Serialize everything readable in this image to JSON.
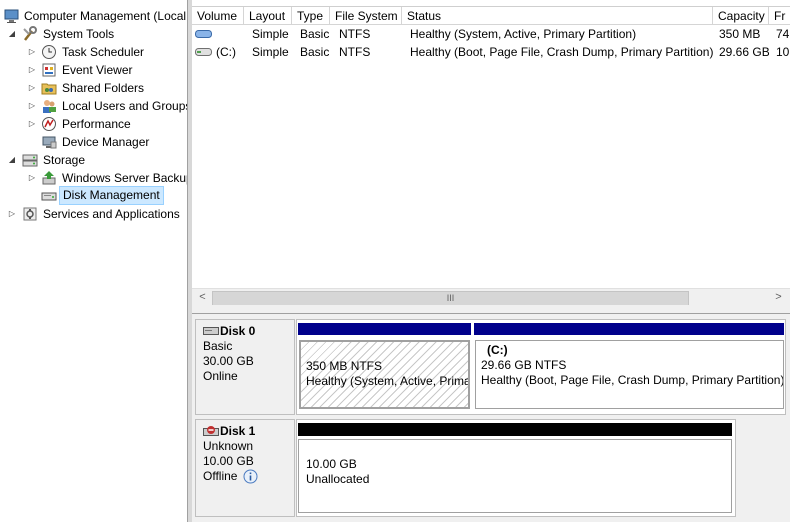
{
  "tree": {
    "root": "Computer Management (Local",
    "system_tools": "System Tools",
    "task_scheduler": "Task Scheduler",
    "event_viewer": "Event Viewer",
    "shared_folders": "Shared Folders",
    "local_users": "Local Users and Groups",
    "performance": "Performance",
    "device_manager": "Device Manager",
    "storage": "Storage",
    "wsb": "Windows Server Backup",
    "disk_management": "Disk Management",
    "services": "Services and Applications"
  },
  "volumes": {
    "columns": [
      "Volume",
      "Layout",
      "Type",
      "File System",
      "Status",
      "Capacity",
      "Fr"
    ],
    "rows": [
      {
        "volume": "",
        "layout": "Simple",
        "type": "Basic",
        "fs": "NTFS",
        "status": "Healthy (System, Active, Primary Partition)",
        "capacity": "350 MB",
        "free": "74"
      },
      {
        "volume": "(C:)",
        "layout": "Simple",
        "type": "Basic",
        "fs": "NTFS",
        "status": "Healthy (Boot, Page File, Crash Dump, Primary Partition)",
        "capacity": "29.66 GB",
        "free": "10"
      }
    ]
  },
  "scrollbar": {
    "left": "<",
    "right": ">",
    "grip": "III"
  },
  "disks": [
    {
      "name": "Disk 0",
      "type": "Basic",
      "size": "30.00 GB",
      "status": "Online",
      "partitions": [
        {
          "label": "",
          "size": "350 MB NTFS",
          "status": "Healthy (System, Active, Prima"
        },
        {
          "label": "(C:)",
          "size": "29.66 GB NTFS",
          "status": "Healthy (Boot, Page File, Crash Dump, Primary Partition)"
        }
      ]
    },
    {
      "name": "Disk 1",
      "type": "Unknown",
      "size": "10.00 GB",
      "status": "Offline",
      "partitions": [
        {
          "size": "10.00 GB",
          "status": "Unallocated"
        }
      ]
    }
  ],
  "colors": {
    "primary_bar": "#00008b",
    "unallocated_bar": "#000000",
    "selection": "#cce8ff"
  }
}
